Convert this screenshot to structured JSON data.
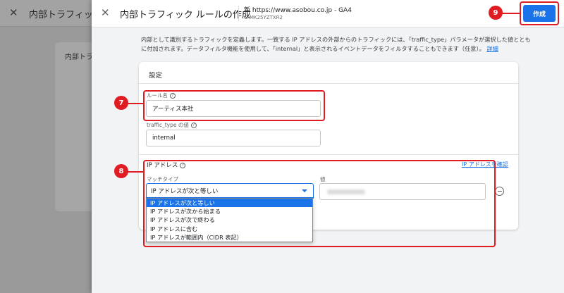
{
  "background": {
    "window_title": "内部トラフィック",
    "card_title": "内部トラ"
  },
  "panel": {
    "title": "内部トラフィック ルールの作成",
    "property_name": "新 https://www.asobou.co.jp - GA4",
    "property_id": "G-MK25YZTXR2",
    "save_label": "作成",
    "description": "内部として識別するトラフィックを定義します。一致する IP アドレスの外部からのトラフィックには、「traffic_type」パラメータが選択した値とともに付加されます。データフィルタ機能を使用して、「internal」と表示されるイベントデータをフィルタすることもできます（任意）。",
    "description_link": "詳細"
  },
  "settings": {
    "card_title": "設定",
    "rule_name_label": "ルール名",
    "rule_name_value": "アーティス本社",
    "traffic_type_label": "traffic_type の値",
    "traffic_type_value": "internal"
  },
  "ip_section": {
    "title": "IP アドレス",
    "check_link": "IP アドレスを確認",
    "match_type_label": "マッチタイプ",
    "match_type_value": "IP アドレスが次と等しい",
    "value_label": "値",
    "options": [
      "IP アドレスが次と等しい",
      "IP アドレスが次から始まる",
      "IP アドレスが次で終わる",
      "IP アドレスに含む",
      "IP アドレスが範囲内（CIDR 表記）"
    ]
  },
  "annotations": {
    "markers": [
      "7",
      "8",
      "9"
    ],
    "color": "#e11b22"
  },
  "colors": {
    "accent": "#1a73e8",
    "annotation": "#e11b22"
  },
  "icons": {
    "close": "close-icon",
    "help": "help-icon",
    "dropdown": "chevron-down-icon",
    "remove": "remove-circle-icon"
  }
}
